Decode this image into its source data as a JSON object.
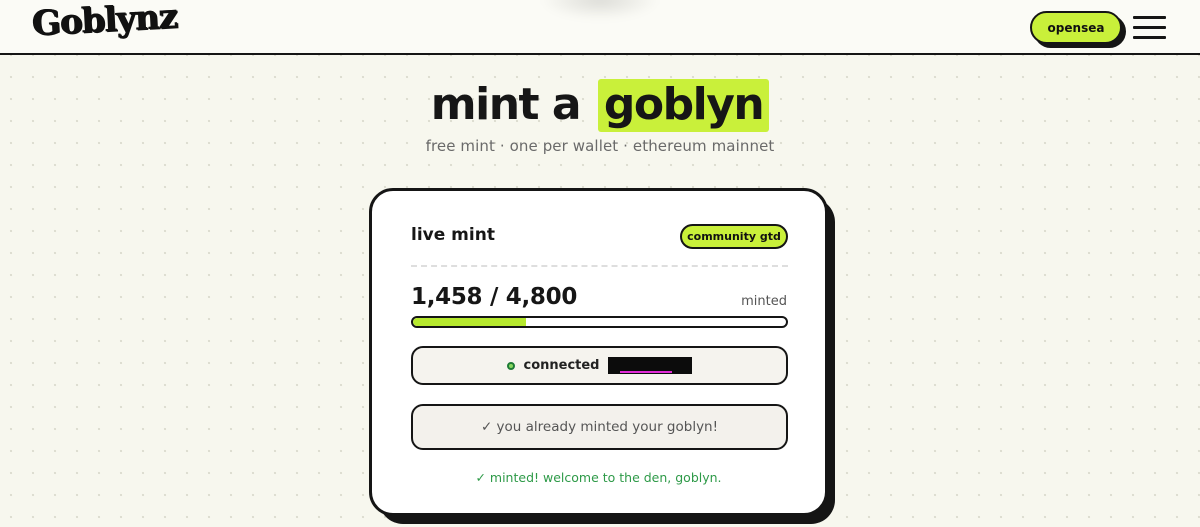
{
  "header": {
    "logo_text": "Goblynz",
    "opensea_label": "opensea",
    "menu_icon": "hamburger-menu-icon"
  },
  "hero": {
    "title_prefix": "mint a",
    "title_highlight": "goblyn",
    "subtitle": "free mint · one per wallet · ethereum mainnet"
  },
  "mint_card": {
    "title": "live mint",
    "badge": "community gtd",
    "count": "1,458 / 4,800",
    "count_label": "minted",
    "progress_percent": 30.4,
    "wallet_status": "connected",
    "status_icon": "status-dot-icon",
    "mint_button_label": "✓ you already minted your goblyn!",
    "success_message": "✓ minted! welcome to the den, goblyn."
  },
  "colors": {
    "accent": "#c9f03a",
    "border": "#151515",
    "background": "#f7f7ee",
    "success": "#2e9a48"
  }
}
